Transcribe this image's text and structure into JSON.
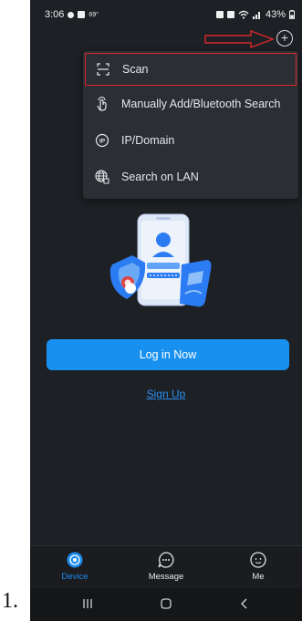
{
  "list_number": "1.",
  "status_bar": {
    "time": "3:06",
    "temp": "69°",
    "battery": "43%"
  },
  "menu": {
    "items": [
      {
        "label": "Scan",
        "icon": "scan-icon"
      },
      {
        "label": "Manually Add/Bluetooth Search",
        "icon": "touch-icon"
      },
      {
        "label": "IP/Domain",
        "icon": "ip-icon"
      },
      {
        "label": "Search on LAN",
        "icon": "lan-globe-icon"
      }
    ]
  },
  "login_button_label": "Log in Now",
  "signup_link_label": "Sign Up",
  "bottom_nav": {
    "items": [
      {
        "label": "Device",
        "active": true
      },
      {
        "label": "Message",
        "active": false
      },
      {
        "label": "Me",
        "active": false
      }
    ]
  },
  "colors": {
    "accent": "#1890f0",
    "background": "#1d2024",
    "annotation_red": "#d8282e"
  }
}
